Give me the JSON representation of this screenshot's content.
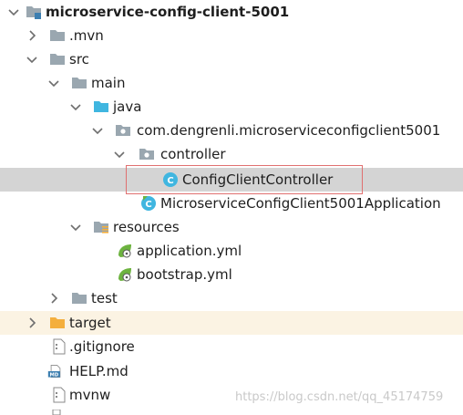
{
  "tree": {
    "items": [
      {
        "label": "microservice-config-client-5001",
        "icon": "module-folder-icon",
        "expanded": true
      },
      {
        "label": ".mvn",
        "icon": "folder-icon",
        "expanded": false
      },
      {
        "label": "src",
        "icon": "folder-icon",
        "expanded": true
      },
      {
        "label": "main",
        "icon": "folder-icon",
        "expanded": true
      },
      {
        "label": "java",
        "icon": "source-folder-icon",
        "expanded": true
      },
      {
        "label": "com.dengrenli.microserviceconfigclient5001",
        "icon": "package-icon",
        "expanded": true
      },
      {
        "label": "controller",
        "icon": "package-icon",
        "expanded": true
      },
      {
        "label": "ConfigClientController",
        "icon": "class-icon"
      },
      {
        "label": "MicroserviceConfigClient5001Application",
        "icon": "spring-boot-class-icon"
      },
      {
        "label": "resources",
        "icon": "resources-folder-icon",
        "expanded": true
      },
      {
        "label": "application.yml",
        "icon": "spring-yml-icon"
      },
      {
        "label": "bootstrap.yml",
        "icon": "spring-yml-icon"
      },
      {
        "label": "test",
        "icon": "folder-icon",
        "expanded": false
      },
      {
        "label": "target",
        "icon": "excluded-folder-icon",
        "expanded": false
      },
      {
        "label": ".gitignore",
        "icon": "text-file-icon"
      },
      {
        "label": "HELP.md",
        "icon": "markdown-file-icon"
      },
      {
        "label": "mvnw",
        "icon": "text-file-icon"
      }
    ]
  },
  "watermark": "https://blog.csdn.net/qq_45174759",
  "colors": {
    "folder": "#9aa7b0",
    "source_folder": "#40b6e0",
    "target_folder": "#f4af3d",
    "selected_row": "#d4d4d4",
    "target_row": "#fbf3e3",
    "class_icon": "#40b6e0",
    "spring_green": "#6db33f",
    "highlight_border": "#e07070"
  }
}
